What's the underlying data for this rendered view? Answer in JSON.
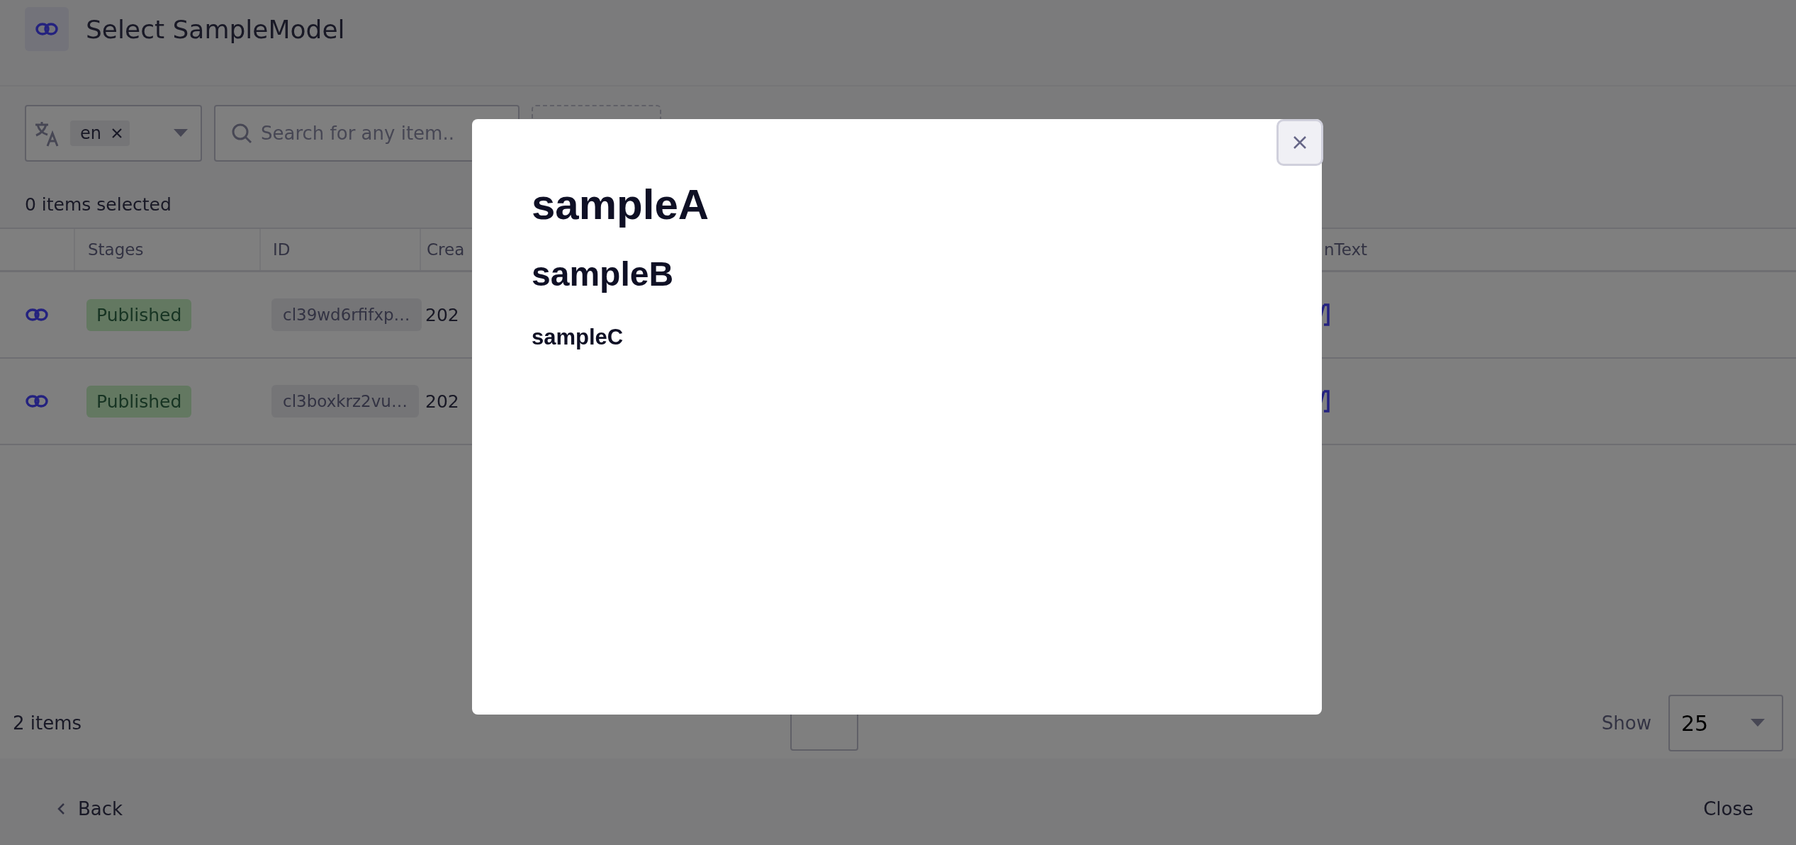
{
  "header": {
    "title": "Select SampleModel"
  },
  "filters": {
    "locale_tag": "en",
    "search": {
      "placeholder": "Search for any item.."
    }
  },
  "selection_count": "0 items selected",
  "table": {
    "columns": [
      "Stages",
      "ID",
      "Crea",
      "nText"
    ],
    "rows": [
      {
        "stage": "Published",
        "id": "cl39wd6rfifxp…",
        "created": "202"
      },
      {
        "stage": "Published",
        "id": "cl3boxkrz2vu…",
        "created": "202"
      }
    ]
  },
  "footer": {
    "count": "2 items",
    "show_label": "Show",
    "page_size": "25"
  },
  "bottom_bar": {
    "back": "Back",
    "close": "Close"
  },
  "modal": {
    "headings": [
      {
        "kind": "large",
        "text": "sampleA"
      },
      {
        "kind": "medium",
        "text": "sampleB"
      },
      {
        "kind": "small",
        "text": "sampleC"
      }
    ]
  }
}
